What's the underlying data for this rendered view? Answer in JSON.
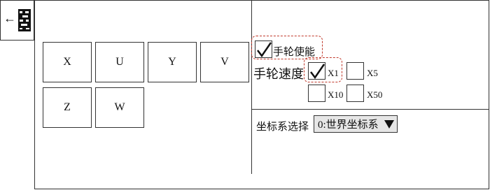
{
  "sidebar": {
    "back_icon": "left-arrow-icon",
    "menu_icon": "qr-menu-icon"
  },
  "axes": [
    "X",
    "U",
    "Y",
    "V",
    "Z",
    "W"
  ],
  "handwheel": {
    "enable_label": "手轮使能",
    "enable_checked": true,
    "speed_label": "手轮速度",
    "rates": [
      {
        "label": "X1",
        "checked": true
      },
      {
        "label": "X5",
        "checked": false
      },
      {
        "label": "X10",
        "checked": false
      },
      {
        "label": "X50",
        "checked": false
      }
    ]
  },
  "coordinate": {
    "label": "坐标系选择",
    "selected": "0:世界坐标系"
  },
  "colors": {
    "highlight": "#c0392b",
    "select_bg": "#e6e6e6"
  }
}
